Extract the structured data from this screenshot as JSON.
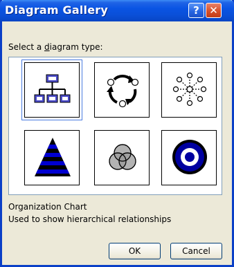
{
  "window": {
    "title": "Diagram Gallery",
    "help_glyph": "?",
    "close_glyph": "✕"
  },
  "prompt": {
    "before": "Select a ",
    "accel": "d",
    "after": "iagram type:"
  },
  "diagram_types": [
    {
      "icon": "organization-chart-icon",
      "selected": true
    },
    {
      "icon": "cycle-diagram-icon",
      "selected": false
    },
    {
      "icon": "radial-diagram-icon",
      "selected": false
    },
    {
      "icon": "pyramid-diagram-icon",
      "selected": false
    },
    {
      "icon": "venn-diagram-icon",
      "selected": false
    },
    {
      "icon": "target-diagram-icon",
      "selected": false
    }
  ],
  "description": {
    "name": "Organization Chart",
    "text": "Used to show hierarchical relationships"
  },
  "buttons": {
    "ok": "OK",
    "cancel": "Cancel"
  },
  "colors": {
    "title_bar": "#0a54e3",
    "dialog_bg": "#ece9d8",
    "diagram_accent": "#0000aa"
  }
}
